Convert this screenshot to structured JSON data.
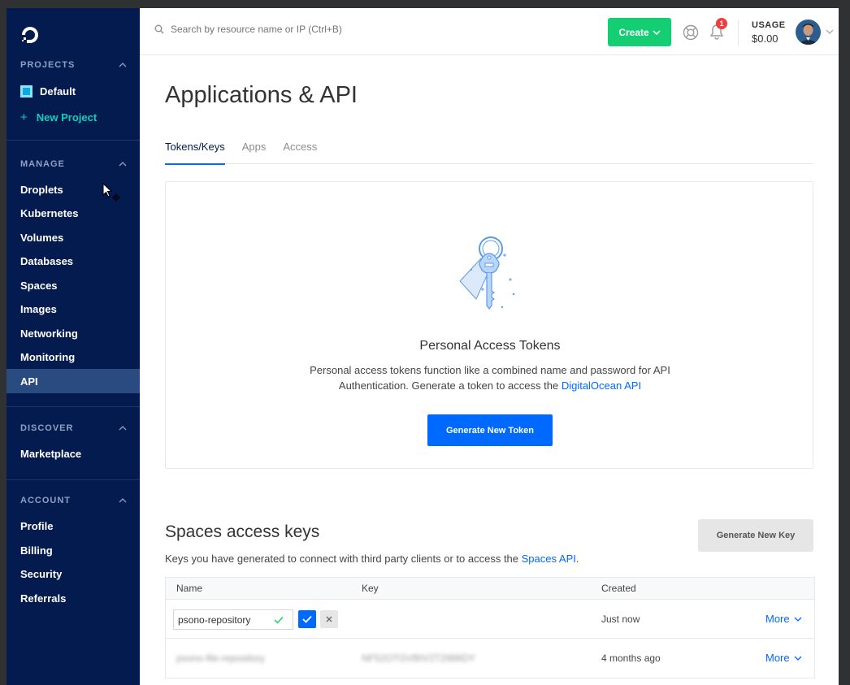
{
  "sidebar": {
    "projects_title": "PROJECTS",
    "default_project": "Default",
    "new_project": "New Project",
    "manage_title": "MANAGE",
    "manage_items": [
      {
        "label": "Droplets"
      },
      {
        "label": "Kubernetes"
      },
      {
        "label": "Volumes"
      },
      {
        "label": "Databases"
      },
      {
        "label": "Spaces"
      },
      {
        "label": "Images"
      },
      {
        "label": "Networking"
      },
      {
        "label": "Monitoring"
      },
      {
        "label": "API",
        "active": true
      }
    ],
    "discover_title": "DISCOVER",
    "discover_items": [
      {
        "label": "Marketplace"
      }
    ],
    "account_title": "ACCOUNT",
    "account_items": [
      {
        "label": "Profile"
      },
      {
        "label": "Billing"
      },
      {
        "label": "Security"
      },
      {
        "label": "Referrals"
      }
    ]
  },
  "topbar": {
    "search_placeholder": "Search by resource name or IP (Ctrl+B)",
    "create_label": "Create",
    "notification_count": "1",
    "usage_label": "USAGE",
    "usage_value": "$0.00"
  },
  "main": {
    "title": "Applications & API",
    "tabs": [
      {
        "label": "Tokens/Keys",
        "active": true
      },
      {
        "label": "Apps"
      },
      {
        "label": "Access"
      }
    ],
    "tokens": {
      "title": "Personal Access Tokens",
      "desc_line1": "Personal access tokens function like a combined name and password for API",
      "desc_line2": "Authentication. Generate a token to access the ",
      "desc_link": "DigitalOcean API",
      "button": "Generate New Token"
    },
    "spaces": {
      "title": "Spaces access keys",
      "desc": "Keys you have generated to connect with third party clients or to access the ",
      "desc_link": "Spaces API",
      "desc_end": ".",
      "button": "Generate New Key",
      "columns": {
        "name": "Name",
        "key": "Key",
        "created": "Created"
      },
      "rows": [
        {
          "name": "psono-repository",
          "key": "",
          "created": "Just now",
          "more": "More"
        },
        {
          "name": "psono-file-repository",
          "key": "NF52OTGVBIV2T2I89IDY",
          "created": "4 months ago",
          "more": "More"
        }
      ]
    }
  },
  "colors": {
    "sidebar_bg": "#031b4e",
    "accent_blue": "#0069ff",
    "create_green": "#15cd72",
    "new_project_teal": "#15cdb9",
    "badge_red": "#f03e3e"
  }
}
